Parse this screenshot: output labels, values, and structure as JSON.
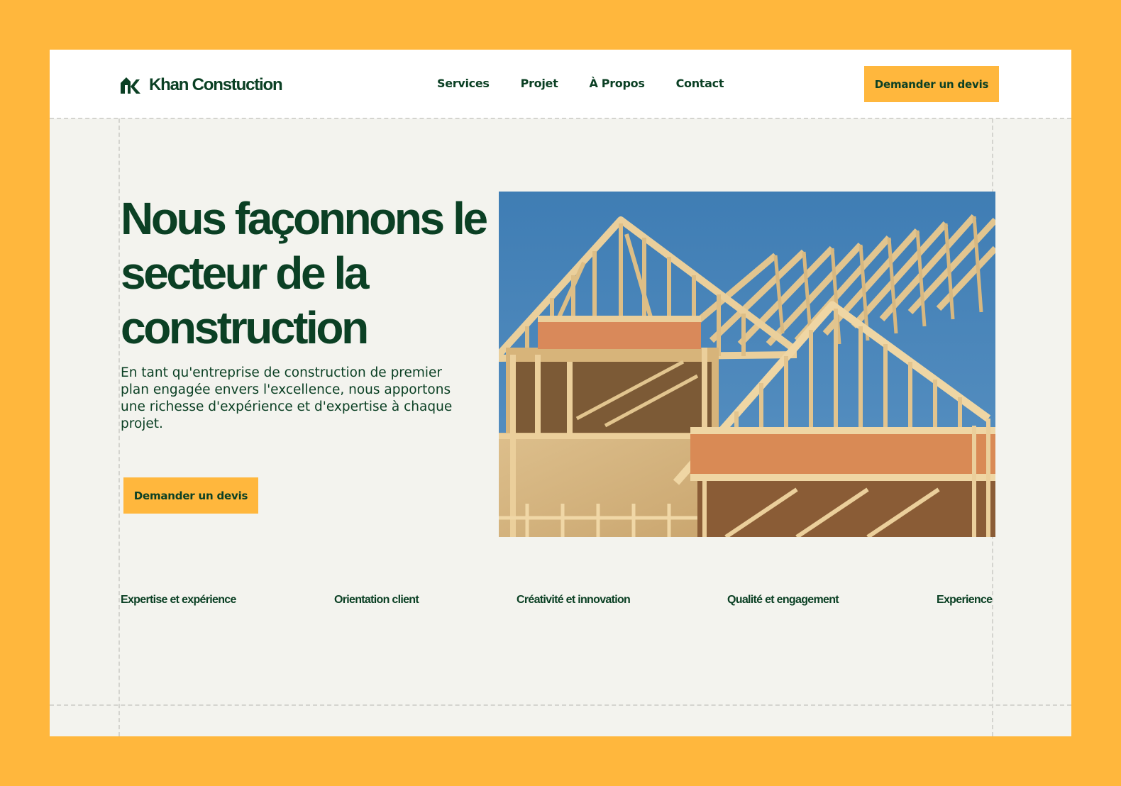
{
  "brand": {
    "name": "Khan Constuction",
    "logo_icon": "house-k-logo-icon"
  },
  "nav": {
    "items": [
      {
        "label": "Services"
      },
      {
        "label": "Projet"
      },
      {
        "label": "À Propos"
      },
      {
        "label": "Contact"
      }
    ]
  },
  "header": {
    "cta_label": "Demander un devis"
  },
  "hero": {
    "title": "Nous façonnons le secteur de la construction",
    "description": "En tant qu'entreprise de construction de premier plan engagée envers l'excellence, nous apportons une richesse d'expérience et d'expertise à chaque projet.",
    "cta_label": "Demander un devis"
  },
  "features": [
    {
      "label": "Expertise et expérience"
    },
    {
      "label": "Orientation client"
    },
    {
      "label": "Créativité et innovation"
    },
    {
      "label": "Qualité et engagement"
    },
    {
      "label": "Experience"
    }
  ],
  "colors": {
    "background_outer": "#FFB73D",
    "accent": "#FFB73D",
    "primary_text": "#0B4024",
    "surface": "#F3F3EE",
    "header_bg": "#FFFFFF"
  }
}
